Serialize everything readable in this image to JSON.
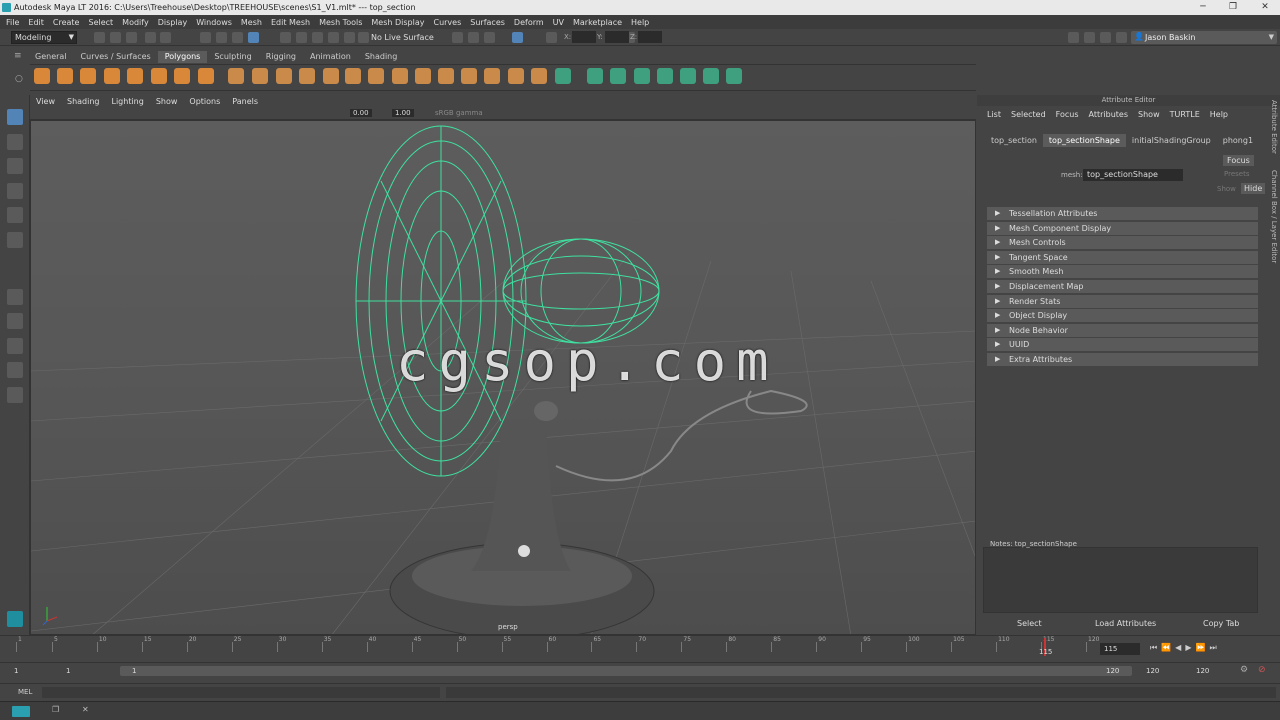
{
  "window": {
    "title": "Autodesk Maya LT 2016: C:\\Users\\Treehouse\\Desktop\\TREEHOUSE\\scenes\\S1_V1.mlt*   ---   top_section"
  },
  "menubar": [
    "File",
    "Edit",
    "Create",
    "Select",
    "Modify",
    "Display",
    "Windows",
    "Mesh",
    "Edit Mesh",
    "Mesh Tools",
    "Mesh Display",
    "Curves",
    "Surfaces",
    "Deform",
    "UV",
    "Marketplace",
    "Help"
  ],
  "statusline": {
    "mode": "Modeling",
    "live_surface": "No Live Surface",
    "user": "Jason Baskin",
    "x_label": "X:",
    "y_label": "Y:",
    "z_label": "Z:"
  },
  "shelf_tabs": [
    "General",
    "Curves / Surfaces",
    "Polygons",
    "Sculpting",
    "Rigging",
    "Animation",
    "Shading"
  ],
  "shelf_active": "Polygons",
  "panel_menu": [
    "View",
    "Shading",
    "Lighting",
    "Show",
    "Options",
    "Panels"
  ],
  "panel_tool": {
    "val1": "0.00",
    "val2": "1.00",
    "colorspace": "sRGB gamma"
  },
  "viewport": {
    "camera": "persp",
    "watermark": "cgsop.com"
  },
  "attr_editor": {
    "header": "Attribute Editor",
    "menu": [
      "List",
      "Selected",
      "Focus",
      "Attributes",
      "Show",
      "TURTLE",
      "Help"
    ],
    "tabs": [
      "top_section",
      "top_sectionShape",
      "initialShadingGroup",
      "phong1"
    ],
    "active_tab": "top_sectionShape",
    "mesh_label": "mesh:",
    "mesh_value": "top_sectionShape",
    "focus": "Focus",
    "presets": "Presets",
    "show": "Show",
    "hide": "Hide",
    "sections": [
      "Tessellation Attributes",
      "Mesh Component Display",
      "Mesh Controls",
      "Tangent Space",
      "Smooth Mesh",
      "Displacement Map",
      "Render Stats",
      "Object Display",
      "Node Behavior",
      "UUID",
      "Extra Attributes"
    ],
    "notes": "Notes:  top_sectionShape",
    "buttons": [
      "Select",
      "Load Attributes",
      "Copy Tab"
    ]
  },
  "right_tabs": [
    "Attribute Editor",
    "Channel Box / Layer Editor"
  ],
  "timeline": {
    "ticks": [
      "1",
      "5",
      "10",
      "15",
      "20",
      "25",
      "30",
      "35",
      "40",
      "45",
      "50",
      "55",
      "60",
      "65",
      "70",
      "75",
      "80",
      "85",
      "90",
      "95",
      "100",
      "105",
      "110",
      "115",
      "120"
    ],
    "current": "115",
    "current_field": "115"
  },
  "range": {
    "start": "1",
    "start2": "1",
    "slider_start": "1",
    "slider_end": "120",
    "end": "120",
    "end2": "120"
  },
  "cmdline": {
    "label": "MEL"
  },
  "colors": {
    "fan_wire": "#3fe0a0",
    "accent": "#5284b8",
    "bg": "#444444"
  }
}
